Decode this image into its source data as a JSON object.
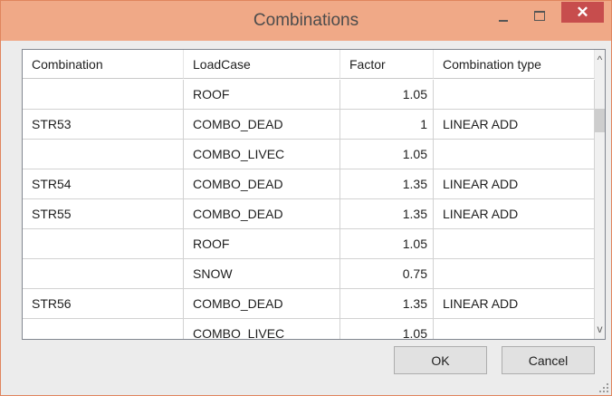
{
  "window": {
    "title": "Combinations"
  },
  "titlebar_buttons": {
    "minimize_glyph": "–",
    "maximize_glyph": "□",
    "close_glyph": "✕"
  },
  "grid": {
    "columns": [
      "Combination",
      "LoadCase",
      "Factor",
      "Combination type"
    ],
    "rows": [
      [
        "",
        "ROOF",
        "1.05",
        ""
      ],
      [
        "STR53",
        "COMBO_DEAD",
        "1",
        "LINEAR ADD"
      ],
      [
        "",
        "COMBO_LIVEC",
        "1.05",
        ""
      ],
      [
        "STR54",
        "COMBO_DEAD",
        "1.35",
        "LINEAR ADD"
      ],
      [
        "STR55",
        "COMBO_DEAD",
        "1.35",
        "LINEAR ADD"
      ],
      [
        "",
        "ROOF",
        "1.05",
        ""
      ],
      [
        "",
        "SNOW",
        "0.75",
        ""
      ],
      [
        "STR56",
        "COMBO_DEAD",
        "1.35",
        "LINEAR ADD"
      ],
      [
        "",
        "COMBO_LIVEC",
        "1.05",
        ""
      ]
    ],
    "scroll_up_glyph": "^",
    "scroll_down_glyph": "v"
  },
  "buttons": {
    "ok": "OK",
    "cancel": "Cancel"
  },
  "colors": {
    "titlebar": "#f0a987",
    "close_button": "#c74d4d",
    "window_border": "#e0855e"
  }
}
